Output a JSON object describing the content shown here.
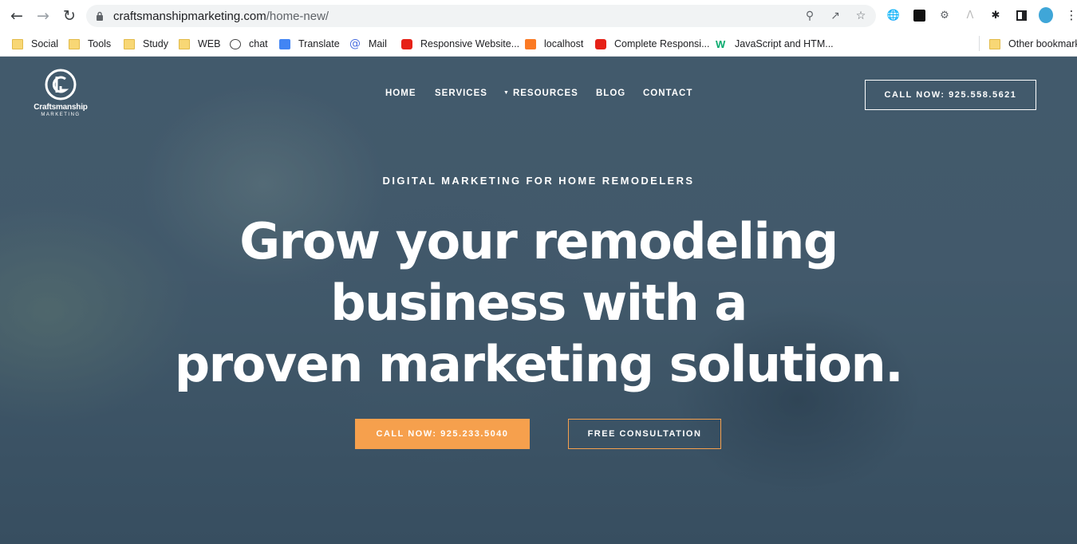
{
  "browser": {
    "url_host": "craftsmanshipmarketing.com",
    "url_path": "/home-new/",
    "bookmarks": [
      {
        "label": "Social",
        "icon": "folder-icon"
      },
      {
        "label": "Tools",
        "icon": "folder-icon"
      },
      {
        "label": "Study",
        "icon": "folder-icon"
      },
      {
        "label": "WEB",
        "icon": "folder-icon"
      },
      {
        "label": "chat",
        "icon": "chatgpt-icon"
      },
      {
        "label": "Translate",
        "icon": "translate-icon"
      },
      {
        "label": "Mail",
        "icon": "mail-icon"
      },
      {
        "label": "Responsive Website...",
        "icon": "youtube-icon"
      },
      {
        "label": "localhost",
        "icon": "xampp-icon"
      },
      {
        "label": "Complete Responsi...",
        "icon": "youtube-icon"
      },
      {
        "label": "JavaScript and HTM...",
        "icon": "w3schools-icon"
      }
    ],
    "other_bookmarks": "Other bookmarks"
  },
  "site": {
    "logo_brand": "Craftsmanship",
    "logo_sub": "MARKETING",
    "nav": [
      "HOME",
      "SERVICES",
      "RESOURCES",
      "BLOG",
      "CONTACT"
    ],
    "call_top": "CALL NOW: 925.558.5621"
  },
  "hero": {
    "eyebrow": "DIGITAL MARKETING FOR HOME REMODELERS",
    "headline": [
      "Grow your remodeling",
      "business with a",
      "proven marketing solution."
    ],
    "cta_primary": "CALL NOW: 925.233.5040",
    "cta_secondary": "FREE CONSULTATION"
  },
  "colors": {
    "accent": "#f6a04d",
    "hero_overlay": "#4b6172",
    "loading_bar": "#f6c52a"
  }
}
